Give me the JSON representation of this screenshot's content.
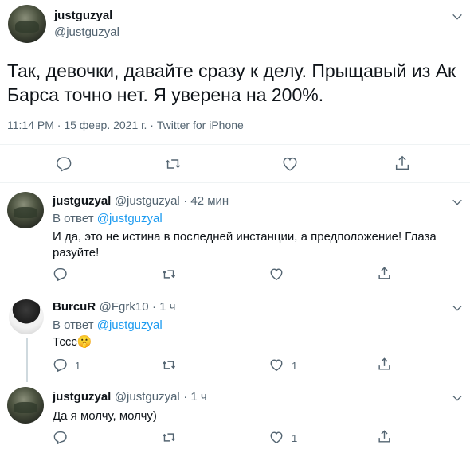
{
  "main_tweet": {
    "display_name": "justguzyal",
    "handle": "@justguzyal",
    "text_line1": "Так, девочки, давайте сразу к делу.  Прыщавый из Ак",
    "text_line2": "Барса точно нет. Я уверена на 200%.",
    "timestamp": "11:14 PM · 15 февр. 2021 г. · ",
    "source": "Twitter for iPhone"
  },
  "replies": [
    {
      "display_name": "justguzyal",
      "handle": "@justguzyal",
      "time": "· 42 мин",
      "reply_to_label": "В ответ ",
      "reply_to_handle": "@justguzyal",
      "text_line1": "И да, это не истина в последней инстанции, а предположение! Глаза",
      "text_line2": "разуйте!",
      "likes": ""
    },
    {
      "display_name": "BurcuR",
      "handle": "@Fgrk10",
      "time": "· 1 ч",
      "reply_to_label": "В ответ ",
      "reply_to_handle": "@justguzyal",
      "text_line1": "Тссс",
      "emoji": "🤫",
      "replies_count": "1",
      "likes": "1"
    },
    {
      "display_name": "justguzyal",
      "handle": "@justguzyal",
      "time": "· 1 ч",
      "text_line1": "Да я молчу, молчу)",
      "likes": "1"
    }
  ],
  "icons": [
    "chevron-down-icon",
    "reply-icon",
    "retweet-icon",
    "like-icon",
    "share-icon"
  ],
  "colors": {
    "accent": "#1d9bf0",
    "secondary_text": "#536471",
    "divider": "#eff3f4"
  }
}
